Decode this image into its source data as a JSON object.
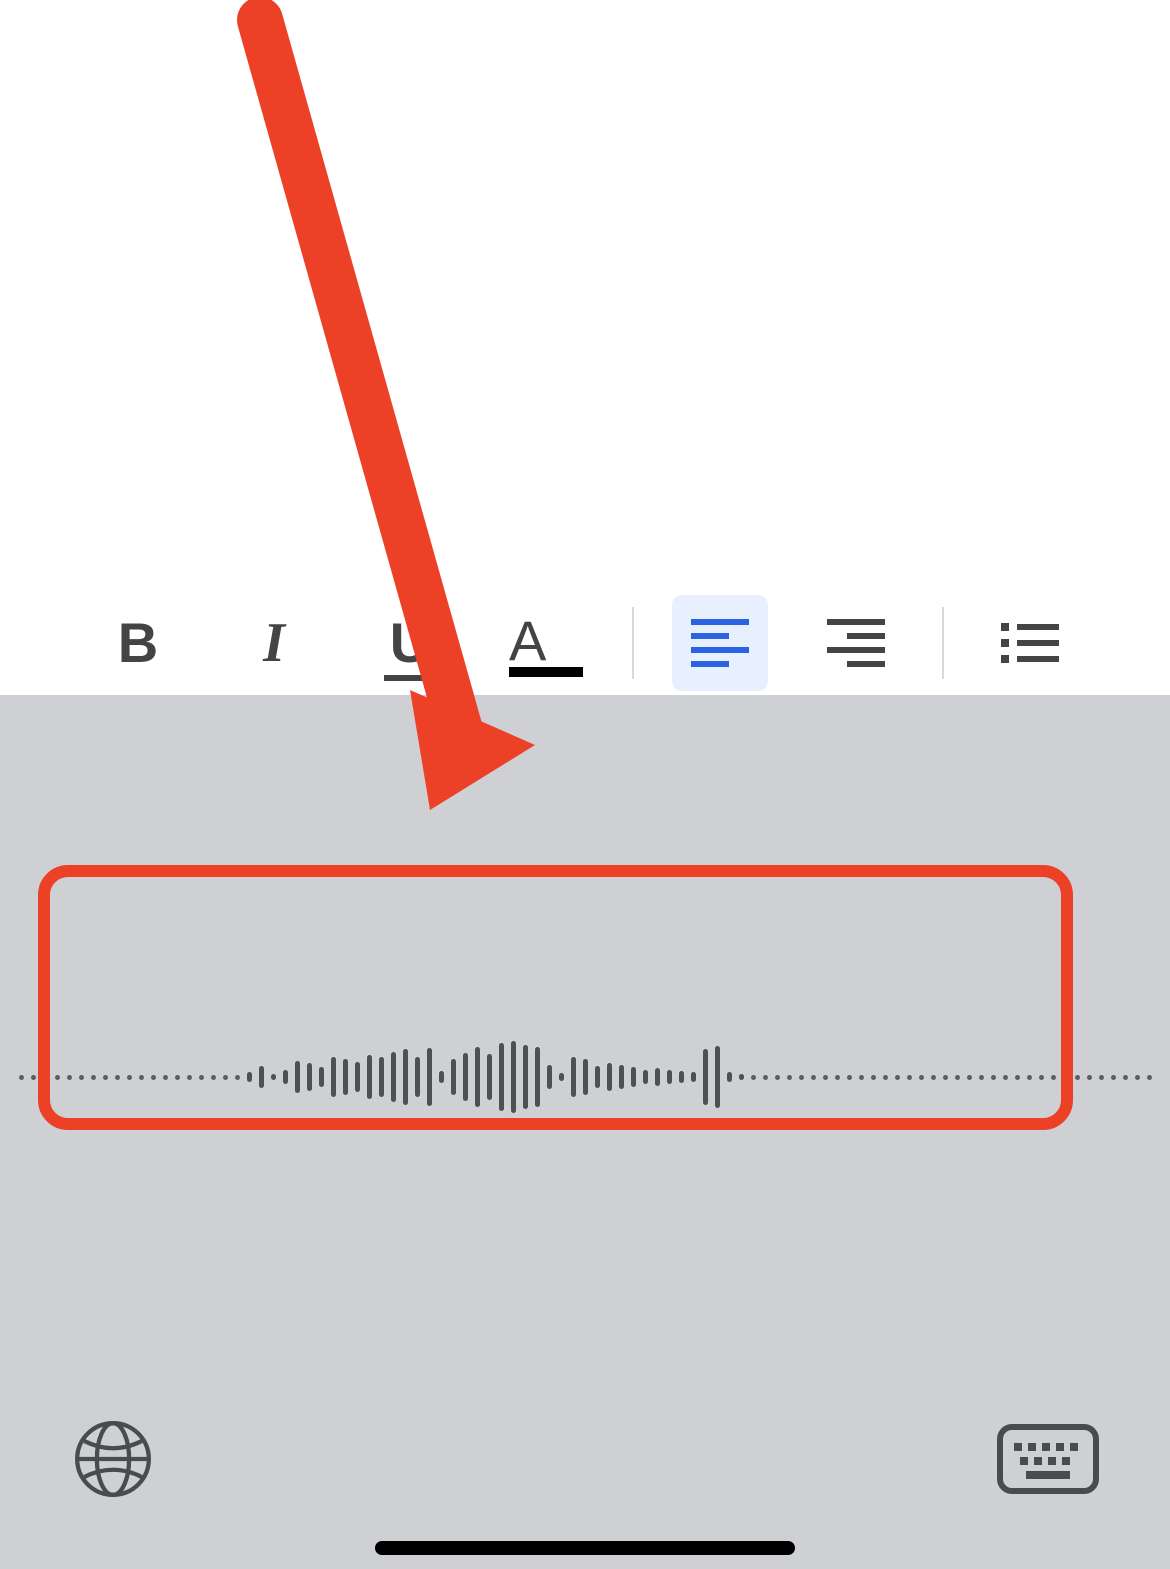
{
  "toolbar": {
    "bold": "B",
    "italic": "I",
    "underline": "U",
    "text_color": "A",
    "align_left_active": true
  },
  "dictation": {
    "waveform_heights": [
      4,
      4,
      4,
      4,
      4,
      4,
      4,
      4,
      4,
      4,
      4,
      4,
      4,
      4,
      4,
      4,
      4,
      4,
      4,
      10,
      22,
      6,
      14,
      32,
      28,
      20,
      40,
      36,
      30,
      44,
      40,
      50,
      56,
      40,
      58,
      12,
      36,
      48,
      60,
      46,
      68,
      72,
      64,
      60,
      24,
      8,
      40,
      36,
      22,
      28,
      24,
      20,
      14,
      18,
      14,
      12,
      10,
      56,
      62,
      10,
      6,
      4,
      4,
      4,
      4,
      4,
      4,
      4,
      4,
      4,
      4,
      4,
      4,
      4,
      4,
      4,
      4,
      4,
      4,
      4,
      4,
      4,
      4,
      4,
      4,
      4,
      4,
      4,
      4,
      4,
      4,
      4,
      4,
      4,
      4
    ]
  },
  "annotation": {
    "color": "#ec4126"
  }
}
